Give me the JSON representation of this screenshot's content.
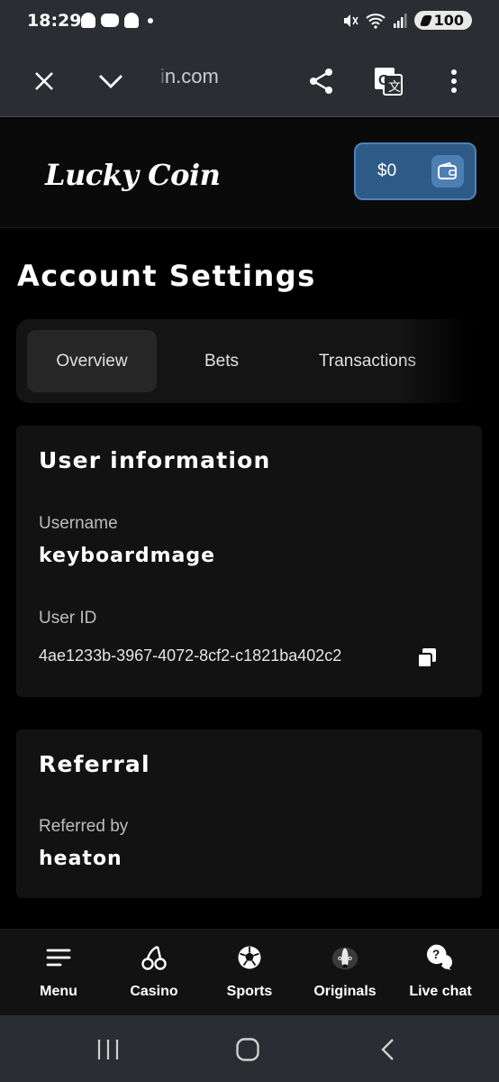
{
  "status_bar": {
    "time": "18:29",
    "battery": "100"
  },
  "browser": {
    "url_faded": "i",
    "url": "n.com"
  },
  "header": {
    "logo": "Lucky Coin",
    "wallet_amount": "$0"
  },
  "page": {
    "title": "Account Settings"
  },
  "tabs": [
    {
      "label": "Overview",
      "active": true
    },
    {
      "label": "Bets",
      "active": false
    },
    {
      "label": "Transactions",
      "active": false
    }
  ],
  "user_info": {
    "title": "User information",
    "username_label": "Username",
    "username": "keyboardmage",
    "user_id_label": "User ID",
    "user_id": "4ae1233b-3967-4072-8cf2-c1821ba402c2"
  },
  "referral": {
    "title": "Referral",
    "referred_by_label": "Referred by",
    "referred_by": "heaton"
  },
  "bottom_nav": [
    {
      "label": "Menu",
      "icon": "menu-icon"
    },
    {
      "label": "Casino",
      "icon": "cherries-icon"
    },
    {
      "label": "Sports",
      "icon": "soccer-ball-icon"
    },
    {
      "label": "Originals",
      "icon": "badger-icon"
    },
    {
      "label": "Live chat",
      "icon": "chat-icon"
    }
  ],
  "colors": {
    "accent": "#2e5a88",
    "background": "#000000",
    "card": "#121212"
  }
}
